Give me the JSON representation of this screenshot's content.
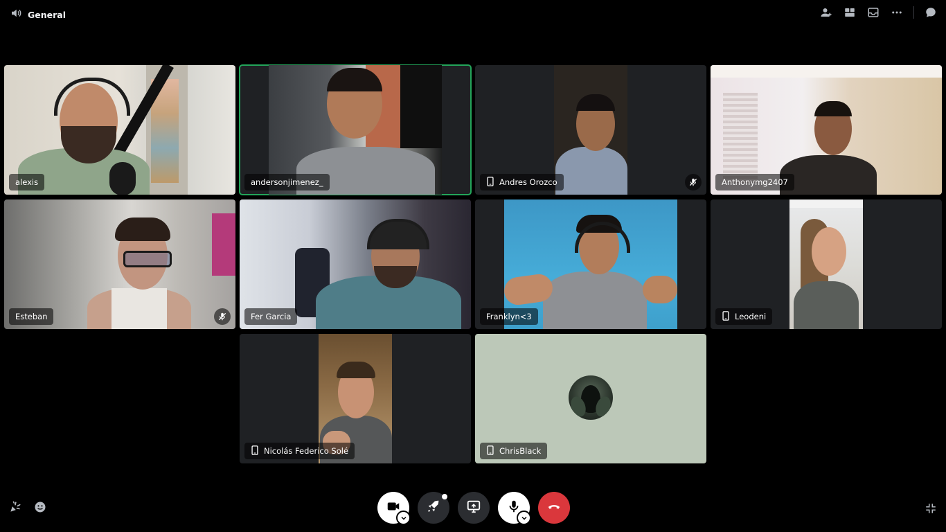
{
  "channel": {
    "name": "General"
  },
  "participants": [
    {
      "name": "alexis"
    },
    {
      "name": "andersonjimenez_"
    },
    {
      "name": "Andres Orozco"
    },
    {
      "name": "Anthonymg2407"
    },
    {
      "name": "Esteban"
    },
    {
      "name": "Fer Garcia"
    },
    {
      "name": "Franklyn<3"
    },
    {
      "name": "Leodeni"
    },
    {
      "name": "Nicolás Federico Solé"
    },
    {
      "name": "ChrisBlack"
    }
  ],
  "colors": {
    "speaking": "#23a55a",
    "hangup": "#da373c",
    "tile_bg": "#1f2124",
    "avatar_tile_bg": "#bcc8b8"
  }
}
